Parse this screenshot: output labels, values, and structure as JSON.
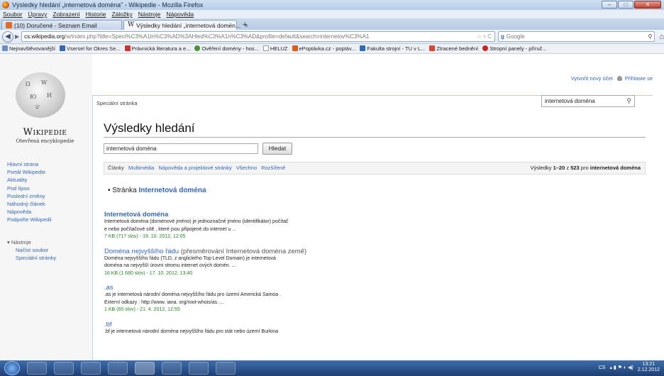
{
  "window": {
    "title": "Výsledky hledání „internetová doména\" - Wikipedie - Mozilla Firefox"
  },
  "menu": [
    "Soubor",
    "Úpravy",
    "Zobrazení",
    "Historie",
    "Záložky",
    "Nástroje",
    "Nápověda"
  ],
  "tabs": [
    {
      "label": "(10) Doručené - Seznam Email"
    },
    {
      "label": "Výsledky hledání „internetová domén..."
    }
  ],
  "url": {
    "domain": "cs.wikipedia.org",
    "path": "/w/index.php?title=Speci%C3%A1ln%C3%AD%3AHled%C3%A1n%C3%AD&profile=default&search=internetov%C3%A1+dom%C3%A9na&fulltext=Search"
  },
  "search": {
    "placeholder": "Google"
  },
  "bookmarks": [
    "Nejnavštěvovanější",
    "Vsersel for Okres Se...",
    "Právnická literatura a e...",
    "Ověření domény - hos...",
    "HELUZ",
    "ePoptávka.cz - poptáv...",
    "Fakulta strojní - TU v L...",
    "Ztracené bednění",
    "Stropní panely - příruč..."
  ],
  "user": {
    "create": "Vytvořit nový účet",
    "login": "Přihlaste se"
  },
  "wiki": {
    "name": "Wikipedie",
    "tagline": "Otevřená encyklopedie"
  },
  "nav": [
    "Hlavní strana",
    "Portál Wikipedie",
    "Aktuality",
    "Pod lípou",
    "Poslední změny",
    "Náhodný článek",
    "Nápověda",
    "Podpořte Wikipedii"
  ],
  "tools": {
    "header": "Nástroje",
    "items": [
      "Načíst soubor",
      "Speciální stránky"
    ]
  },
  "special_tab": "Speciální stránka",
  "wiki_search_value": "internetová doména",
  "heading": "Výsledky hledání",
  "search_input": "internetová doména",
  "search_button": "Hledat",
  "filters": [
    "Články",
    "Multimédia",
    "Nápověda a projektové stránky",
    "Všechno",
    "Rozšířené"
  ],
  "stats": {
    "prefix": "Výsledky ",
    "range": "1–20",
    "mid": " z ",
    "total": "523",
    "pro": " pro ",
    "query": "internetová doména"
  },
  "page_hit": {
    "prefix": "Stránka ",
    "title": "Internetová doména"
  },
  "results": [
    {
      "title": "Internetová doména",
      "title_extra": "",
      "snippet": [
        "Internetová doména (doménové jméno) je jednoznačné jméno (identifikátor) počítač",
        "e nebo počítačové sítě , které jsou připojené do internet u ..."
      ],
      "meta": "7 KB (717 slov) - 19. 10. 2012, 12:05"
    },
    {
      "title": "Doména nejvyššího řádu",
      "title_extra": " (přesměrování Internetová doména země)",
      "snippet": [
        "Doména nejvyššího řádu (TLD, z anglického Top Level Domain) je internetová",
        "doména na nejvyšší úrovni stromu internet ových domén. ..."
      ],
      "meta": "16 KB (1 680 slov) - 17. 10. 2012, 13:40"
    },
    {
      "title": ".as",
      "title_extra": "",
      "snippet": [
        ".as je internetová národní doména nejvyššího řádu pro území Americká Samoa .",
        "Externí odkazy : http://www. iana. org/root-whois/as. ..."
      ],
      "meta": "1 KB (65 slov) - 21. 4. 2012, 12:55"
    },
    {
      "title": ".bf",
      "title_extra": "",
      "snippet": [
        ".bf je internetová národní doména nejvyššího řádu pro stát nebo území Burkina"
      ],
      "meta": ""
    }
  ],
  "taskbar": {
    "lang": "CS",
    "time": "13:21",
    "date": "2.12.2012"
  }
}
